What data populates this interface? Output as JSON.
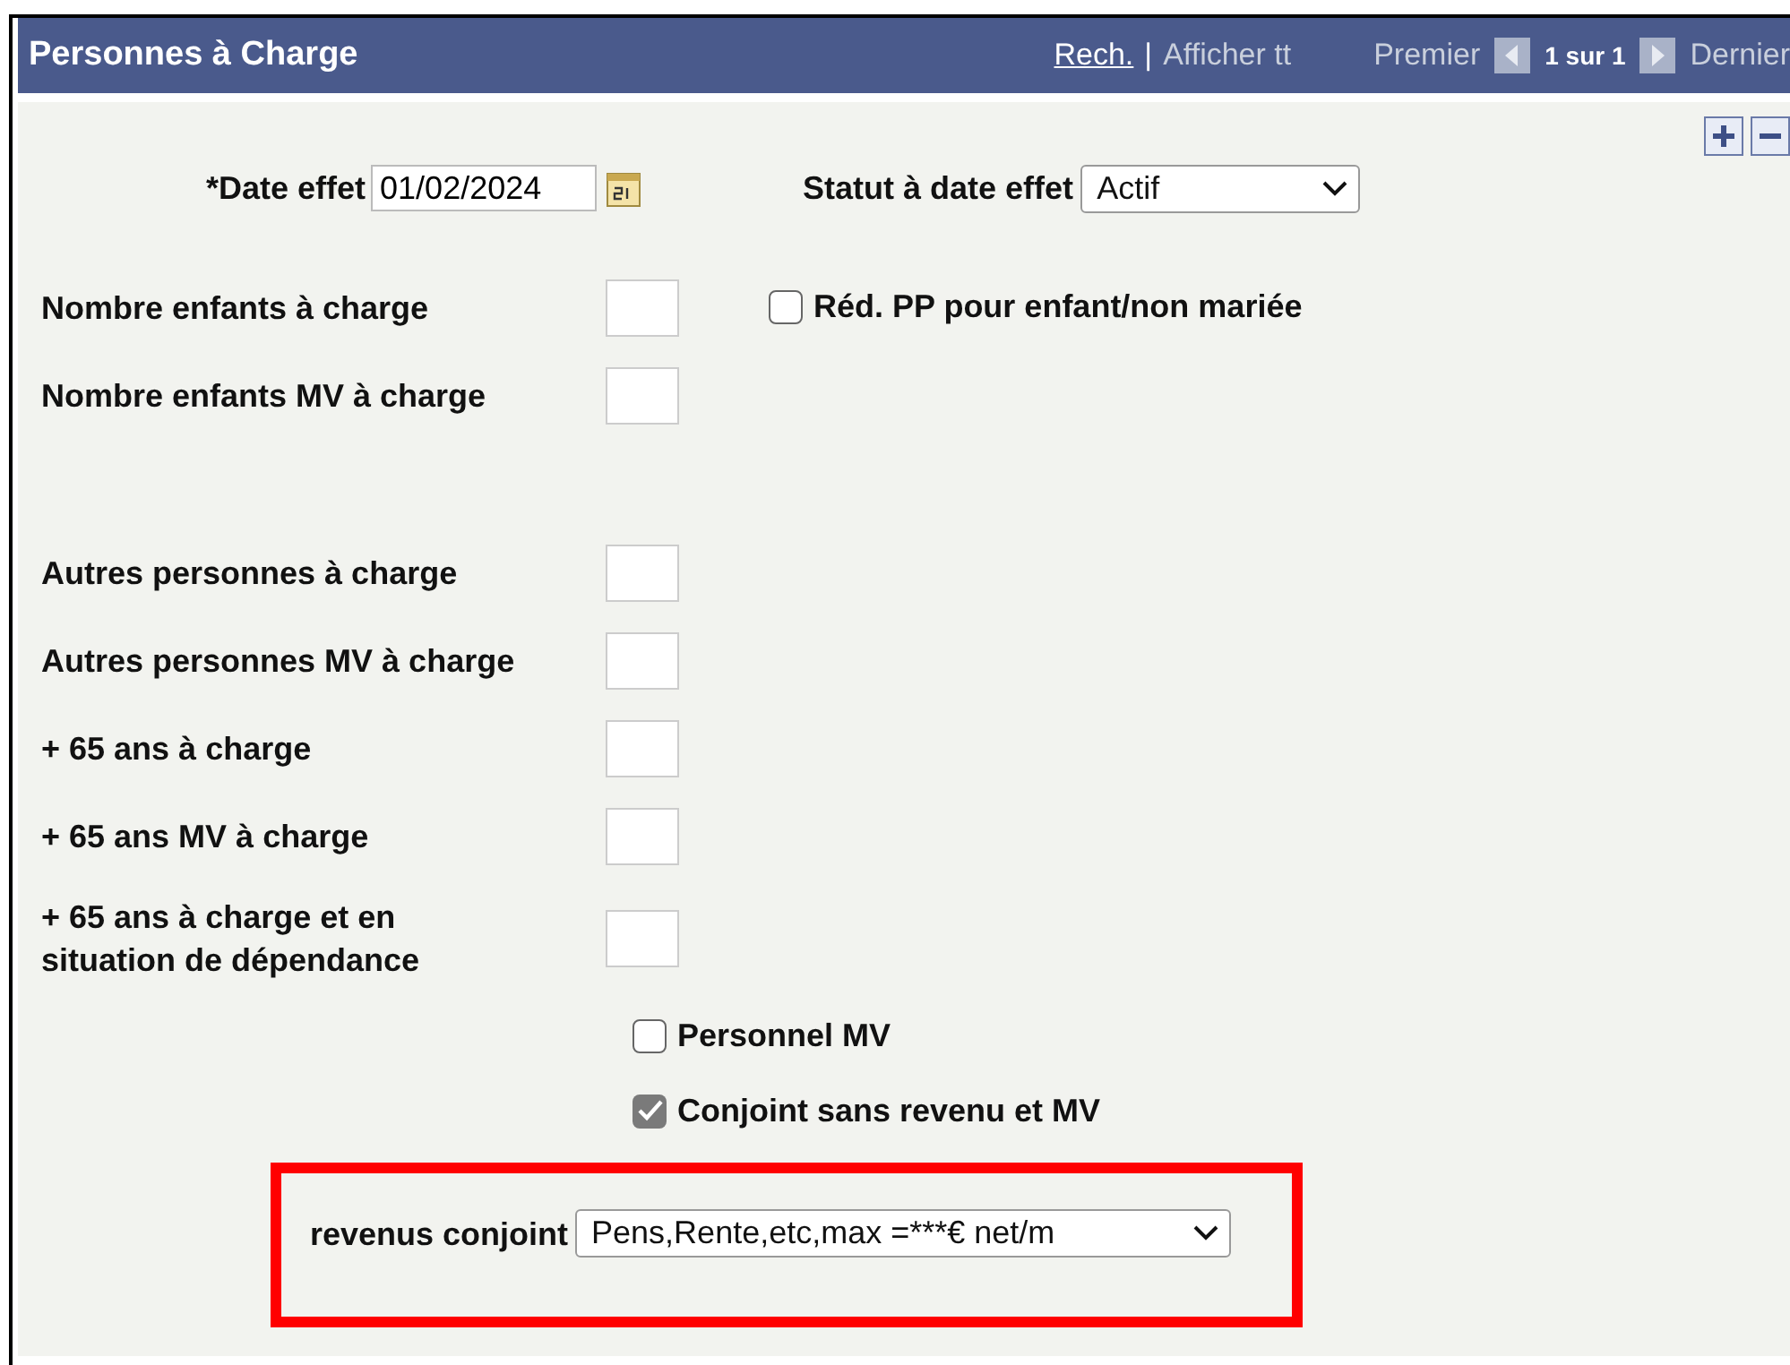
{
  "header": {
    "title": "Personnes à Charge",
    "links": [
      {
        "label": "Rech.",
        "kind": "link"
      },
      {
        "label": "Afficher tt",
        "kind": "muted"
      }
    ],
    "separator": "|",
    "first": "Premier",
    "counter": "1 sur 1",
    "last": "Dernier"
  },
  "date_effet": {
    "label": "*Date effet",
    "value": "01/02/2024"
  },
  "statut": {
    "label": "Statut à date effet",
    "value": "Actif"
  },
  "child_fields": [
    {
      "label": "Nombre enfants à charge"
    },
    {
      "label": "Nombre enfants MV à charge"
    }
  ],
  "reduction": {
    "label": "Réd. PP pour enfant/non mariée",
    "checked": false
  },
  "other_fields": [
    {
      "label": "Autres personnes à charge"
    },
    {
      "label": "Autres personnes MV à charge"
    },
    {
      "label": "+ 65 ans à charge"
    },
    {
      "label": "+ 65 ans MV à charge"
    },
    {
      "label": "+ 65 ans à charge et en situation de dépendance"
    }
  ],
  "checkboxes": [
    {
      "label": "Personnel MV",
      "checked": false
    },
    {
      "label": "Conjoint sans revenu et MV",
      "checked": true
    }
  ],
  "revenus": {
    "label": "revenus conjoint",
    "value": "Pens,Rente,etc,max =***€ net/m",
    "highlighted": true
  }
}
